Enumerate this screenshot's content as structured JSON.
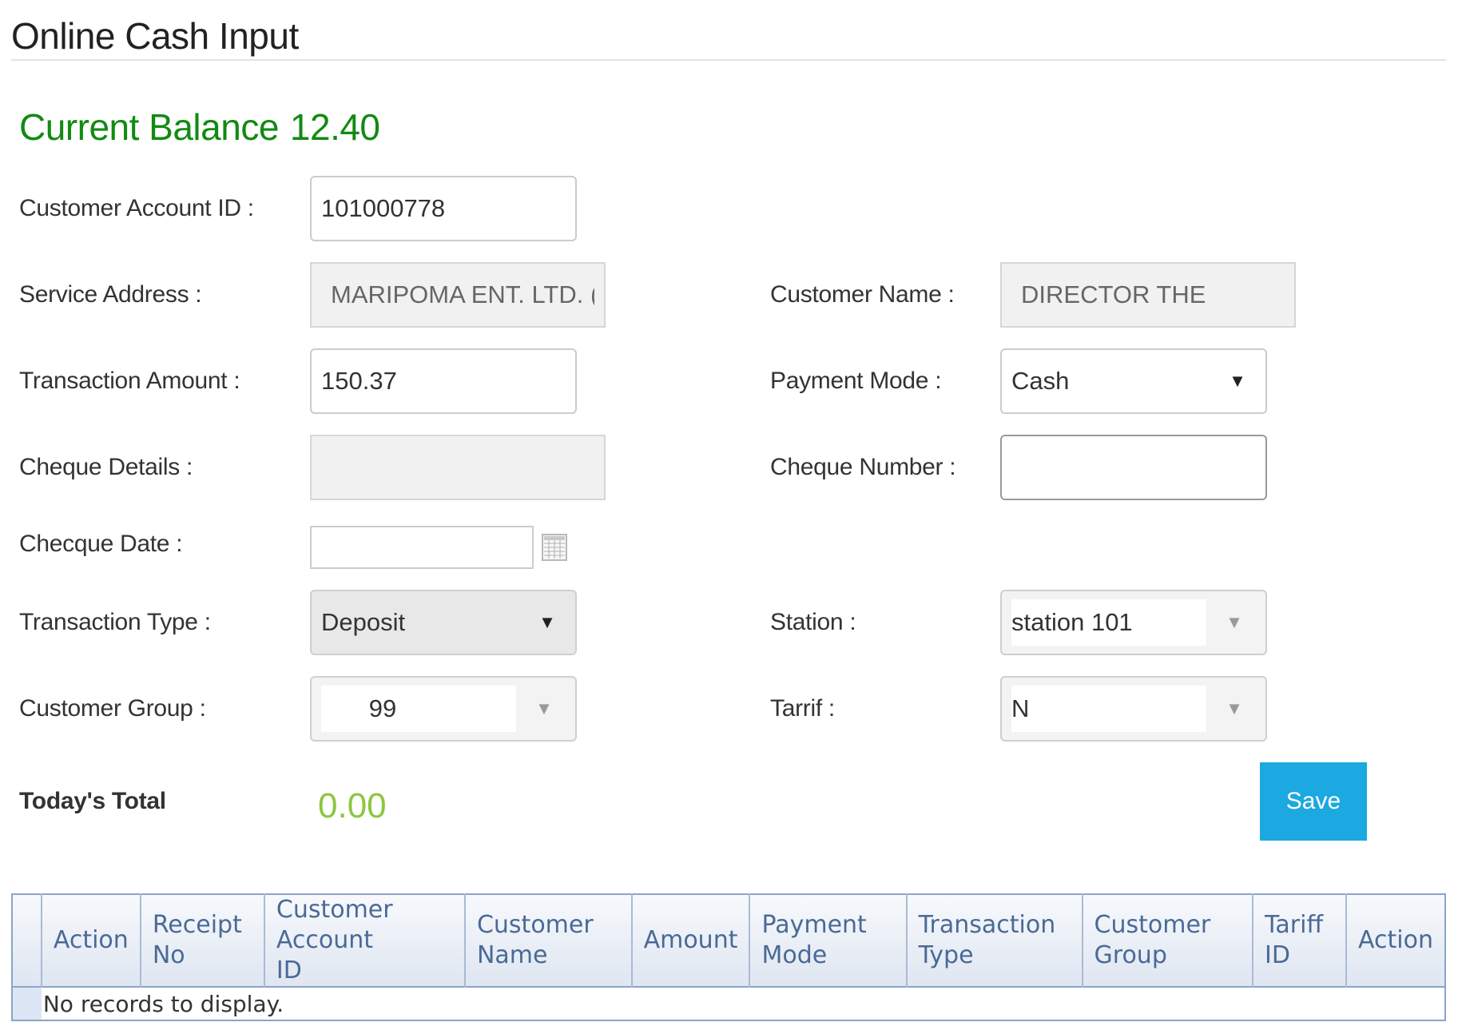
{
  "page": {
    "title": "Online Cash Input"
  },
  "balance": {
    "label": "Current Balance",
    "value": "12.40"
  },
  "form": {
    "customer_account_id": {
      "label": "Customer Account ID :",
      "value": "101000778"
    },
    "service_address": {
      "label": "Service Address :",
      "value": "MARIPOMA ENT. LTD. (S"
    },
    "customer_name": {
      "label": "Customer Name :",
      "value": "DIRECTOR THE"
    },
    "transaction_amount": {
      "label": "Transaction Amount :",
      "value": "150.37"
    },
    "payment_mode": {
      "label": "Payment Mode :",
      "value": "Cash"
    },
    "cheque_details": {
      "label": "Cheque Details :",
      "value": ""
    },
    "cheque_number": {
      "label": "Cheque Number :",
      "value": ""
    },
    "cheque_date": {
      "label": "Checque Date :",
      "value": ""
    },
    "transaction_type": {
      "label": "Transaction Type :",
      "value": "Deposit"
    },
    "station": {
      "label": "Station :",
      "value": "station 101"
    },
    "customer_group": {
      "label": "Customer Group :",
      "value": "99"
    },
    "tarrif": {
      "label": "Tarrif :",
      "value": "N"
    }
  },
  "totals": {
    "label": "Today's Total",
    "value": "0.00"
  },
  "actions": {
    "save_label": "Save"
  },
  "grid": {
    "columns": [
      {
        "line1": "Action",
        "line2": ""
      },
      {
        "line1": "Receipt",
        "line2": "No"
      },
      {
        "line1": "Customer Account",
        "line2": "ID"
      },
      {
        "line1": "Customer",
        "line2": "Name"
      },
      {
        "line1": "Amount",
        "line2": ""
      },
      {
        "line1": "Payment",
        "line2": "Mode"
      },
      {
        "line1": "Transaction",
        "line2": "Type"
      },
      {
        "line1": "Customer",
        "line2": "Group"
      },
      {
        "line1": "Tariff",
        "line2": "ID"
      },
      {
        "line1": "Action",
        "line2": ""
      }
    ],
    "empty_message": "No records to display."
  },
  "colors": {
    "balance": "#128a12",
    "total": "#8cc63f",
    "save_button": "#1ca8e0",
    "grid_header_text": "#4a6a96"
  },
  "icons": {
    "calendar": "calendar-icon",
    "dropdown": "chevron-down-icon"
  }
}
